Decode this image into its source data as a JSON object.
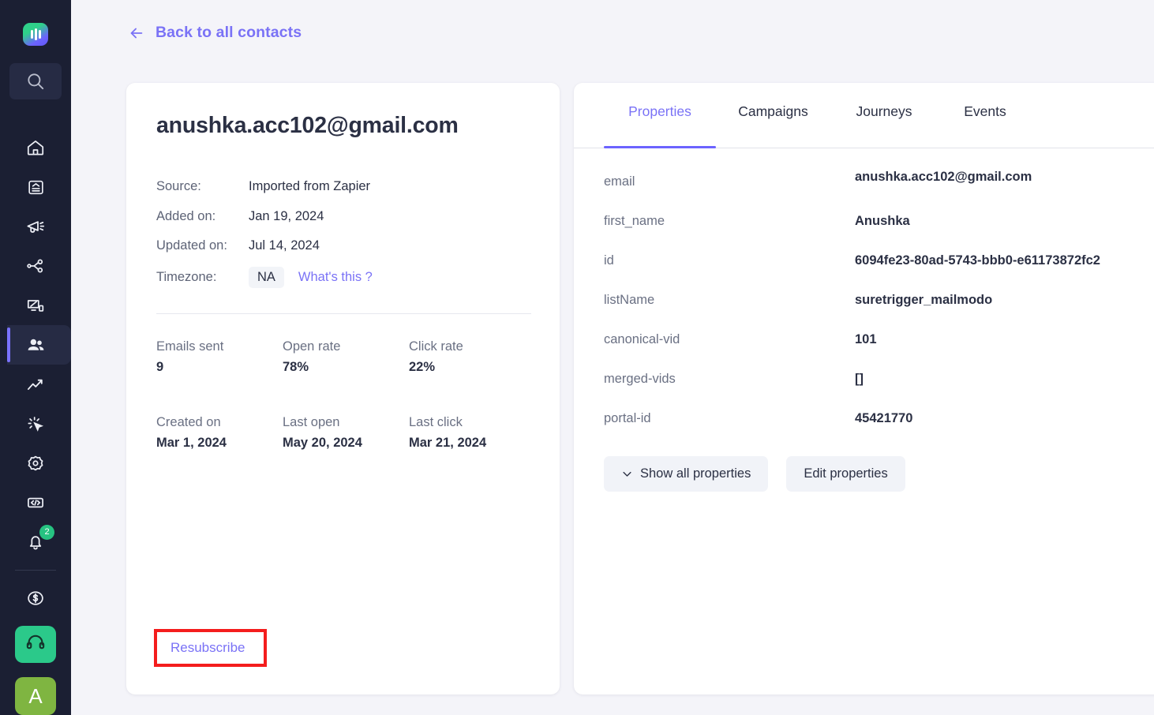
{
  "sidebar": {
    "logo_name": "mailmodo-logo",
    "search_placeholder": "Search",
    "items": [
      {
        "name": "home",
        "icon": "home-icon"
      },
      {
        "name": "templates",
        "icon": "document-icon"
      },
      {
        "name": "campaigns",
        "icon": "megaphone-icon"
      },
      {
        "name": "journeys",
        "icon": "share-nodes-icon"
      },
      {
        "name": "forms",
        "icon": "screen-share-icon"
      },
      {
        "name": "contacts",
        "icon": "users-icon",
        "active": true
      },
      {
        "name": "analytics",
        "icon": "line-chart-icon"
      },
      {
        "name": "events",
        "icon": "cursor-click-icon"
      },
      {
        "name": "settings",
        "icon": "gear-icon"
      },
      {
        "name": "developers",
        "icon": "code-brackets-icon"
      },
      {
        "name": "notifications",
        "icon": "bell-icon",
        "badge": "2"
      }
    ],
    "billing_icon": "dollar-circle-icon",
    "support_icon": "headset-icon",
    "avatar_initial": "A"
  },
  "header": {
    "back_label": "Back to all contacts",
    "back_icon": "arrow-left-icon"
  },
  "contact": {
    "email": "anushka.acc102@gmail.com",
    "meta": [
      {
        "label": "Source:",
        "value": "Imported from Zapier"
      },
      {
        "label": "Added on:",
        "value": "Jan 19, 2024"
      },
      {
        "label": "Updated on:",
        "value": "Jul 14, 2024"
      }
    ],
    "timezone_label": "Timezone:",
    "timezone_value": "NA",
    "timezone_help": "What's this ?",
    "stats": [
      {
        "label": "Emails sent",
        "value": "9"
      },
      {
        "label": "Open rate",
        "value": "78%"
      },
      {
        "label": "Click rate",
        "value": "22%"
      },
      {
        "label": "Created on",
        "value": "Mar 1, 2024"
      },
      {
        "label": "Last open",
        "value": "May 20, 2024"
      },
      {
        "label": "Last click",
        "value": "Mar 21, 2024"
      }
    ],
    "resubscribe_label": "Resubscribe"
  },
  "panel": {
    "tabs": [
      {
        "label": "Properties",
        "active": true
      },
      {
        "label": "Campaigns",
        "active": false
      },
      {
        "label": "Journeys",
        "active": false
      },
      {
        "label": "Events",
        "active": false
      }
    ],
    "properties": [
      {
        "key": "email",
        "value": "anushka.acc102@gmail.com"
      },
      {
        "key": "first_name",
        "value": "Anushka"
      },
      {
        "key": "id",
        "value": "6094fe23-80ad-5743-bbb0-e61173872fc2"
      },
      {
        "key": "listName",
        "value": "suretrigger_mailmodo"
      },
      {
        "key": "canonical-vid",
        "value": "101"
      },
      {
        "key": "merged-vids",
        "value": "[]"
      },
      {
        "key": "portal-id",
        "value": "45421770"
      }
    ],
    "show_all_label": "Show all properties",
    "show_all_icon": "chevron-down-icon",
    "edit_label": "Edit properties"
  },
  "colors": {
    "accent_purple": "#7a72f6",
    "tab_underline": "#6c63ff",
    "sidebar_bg": "#1b1f33",
    "sidebar_active_bg": "#262b44",
    "page_bg": "#f4f4f9",
    "highlight_red": "#f41d1d",
    "badge_green": "#26c281",
    "support_green": "#2bc98a",
    "avatar_green": "#7fb541",
    "text_dark": "#2b3044",
    "text_muted": "#6a7083"
  }
}
